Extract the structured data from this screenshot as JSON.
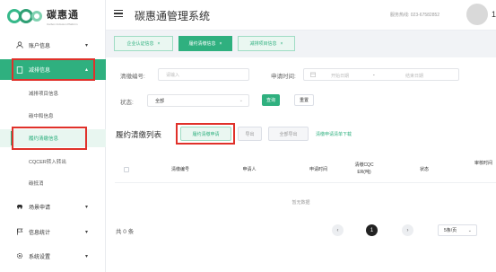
{
  "logo": {
    "name": "碳惠通",
    "sub": "Carbon Inclusion Platform"
  },
  "header": {
    "title": "碳惠通管理系统",
    "hotline": "服务热线: 023-67582852",
    "user_initial": "1"
  },
  "sidebar": {
    "items": [
      {
        "icon": "user-icon",
        "label": "账户信息",
        "arrow": "▾"
      },
      {
        "icon": "document-icon",
        "label": "减排信息",
        "arrow": "▴",
        "active": true
      },
      {
        "icon": "car-icon",
        "label": "场景申请",
        "arrow": "▾"
      },
      {
        "icon": "flag-icon",
        "label": "信息统计",
        "arrow": "▾"
      },
      {
        "icon": "gear-icon",
        "label": "系统设置",
        "arrow": "▾"
      }
    ],
    "sub_items": [
      {
        "label": "减排项目信息"
      },
      {
        "label": "碳中和信息"
      },
      {
        "label": "履约清缴信息",
        "active": true
      },
      {
        "label": "CQCER转入转出"
      },
      {
        "label": "碳抵消"
      }
    ]
  },
  "tabs": [
    {
      "label": "企业认证信息",
      "close": "×"
    },
    {
      "label": "履约清缴信息",
      "close": "×",
      "active": true
    },
    {
      "label": "减排项目信息",
      "close": "×"
    }
  ],
  "search": {
    "code_label": "清缴编号:",
    "code_placeholder": "请输入",
    "time_label": "申请时间:",
    "start_placeholder": "开始日期",
    "separator": "-",
    "end_placeholder": "结束日期",
    "status_label": "状态:",
    "status_value": "全部",
    "query_button": "查询",
    "reset_button": "重置"
  },
  "list": {
    "title": "履约清缴列表",
    "apply_button": "履约清缴申请",
    "export_button": "导出",
    "export_all_button": "全部导出",
    "template_link": "清缴申请清单下载"
  },
  "table": {
    "columns": [
      "清缴编号",
      "申请人",
      "申请时间",
      "清缴CQC ER(吨)",
      "状态",
      "审核时间"
    ],
    "empty_text": "暂无数据"
  },
  "pagination": {
    "total": "共 0 条",
    "prev": "‹",
    "current": "1",
    "next": "›",
    "page_size": "5条/页"
  }
}
